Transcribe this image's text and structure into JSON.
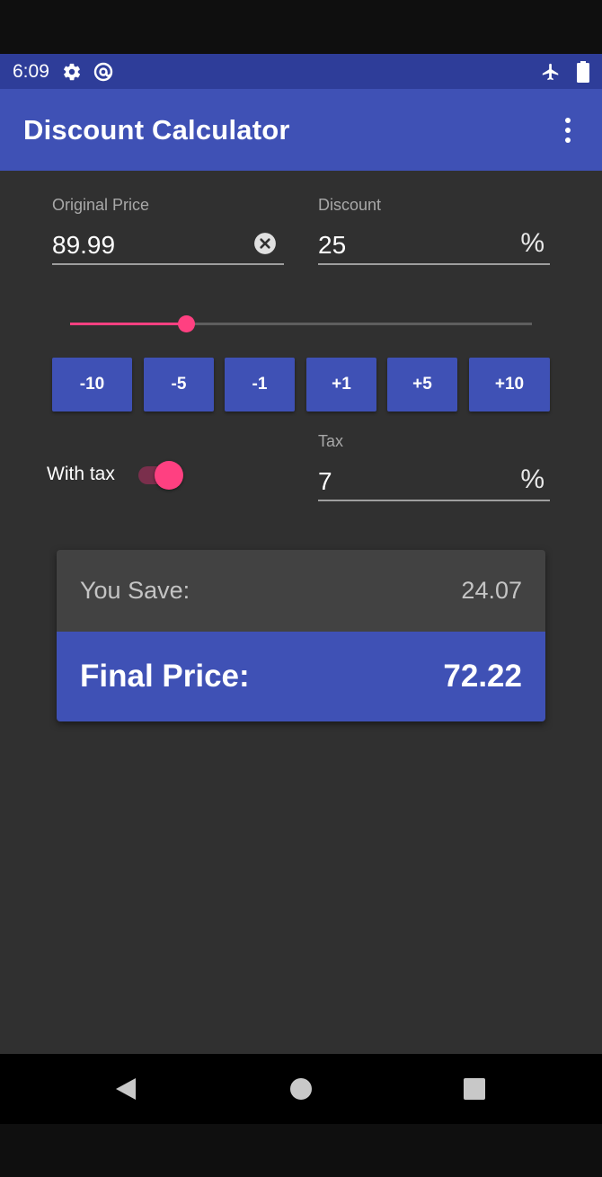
{
  "status_bar": {
    "time": "6:09",
    "icons": [
      "settings-icon",
      "at-sign-icon",
      "airplane-icon",
      "battery-icon"
    ]
  },
  "app_bar": {
    "title": "Discount Calculator",
    "overflow_icon": "more-vert-icon"
  },
  "form": {
    "original_price": {
      "label": "Original Price",
      "value": "89.99",
      "clear_icon": "clear-circle-icon"
    },
    "discount": {
      "label": "Discount",
      "value": "25",
      "suffix": "%"
    },
    "slider": {
      "value_fraction": 0.25
    },
    "step_buttons": [
      "-10",
      "-5",
      "-1",
      "+1",
      "+5",
      "+10"
    ],
    "with_tax": {
      "label": "With tax",
      "checked": true
    },
    "tax": {
      "label": "Tax",
      "value": "7",
      "suffix": "%"
    }
  },
  "result": {
    "save_label": "You Save:",
    "save_value": "24.07",
    "final_label": "Final Price:",
    "final_value": "72.22"
  },
  "navigation": {
    "buttons": [
      "back-icon",
      "home-icon",
      "recents-icon"
    ]
  },
  "colors": {
    "primary": "#3f51b5",
    "primary_dark": "#2e3d99",
    "accent": "#ff4081",
    "background": "#303030"
  }
}
